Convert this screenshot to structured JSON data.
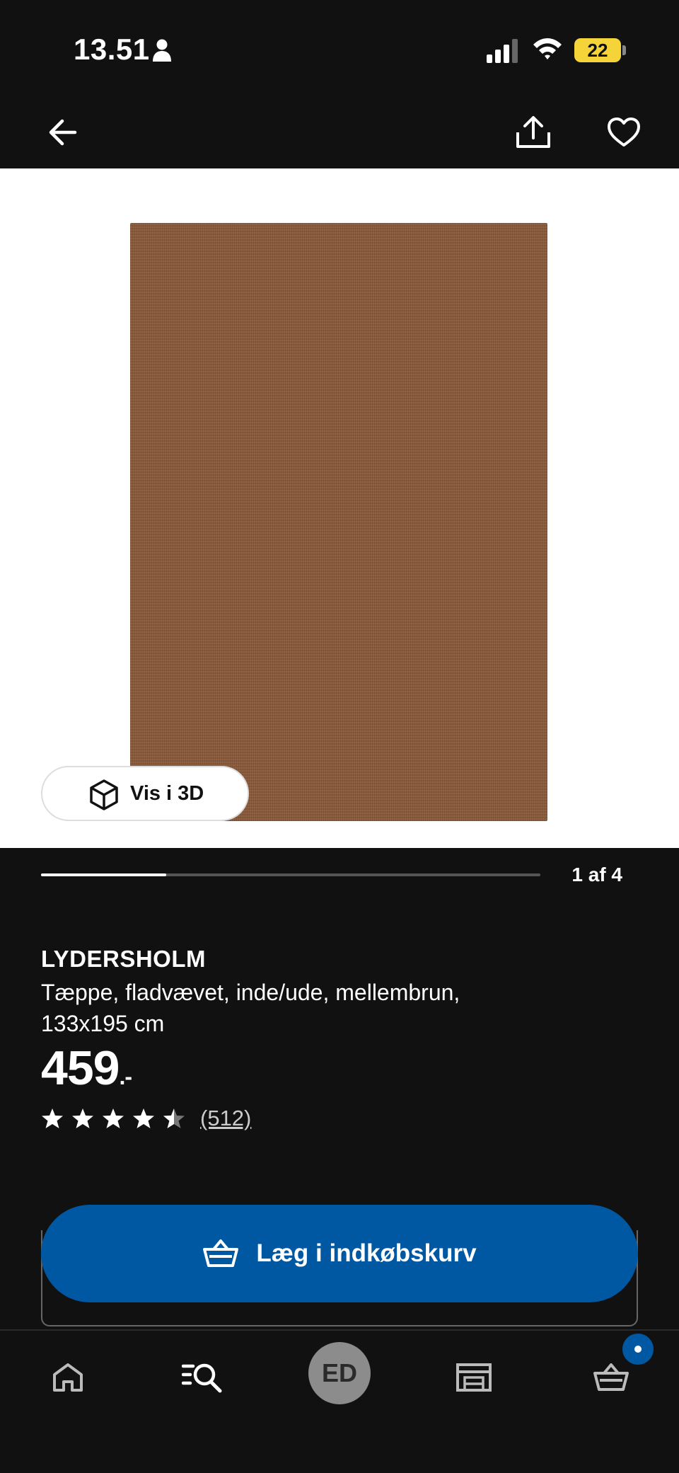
{
  "status_bar": {
    "time": "13.51",
    "battery": "22"
  },
  "top_nav": {
    "back_icon": "arrow-left-icon",
    "share_icon": "share-icon",
    "favorite_icon": "heart-icon"
  },
  "gallery": {
    "view_3d_label": "Vis i 3D",
    "counter": "1 af 4",
    "current": 1,
    "total": 4
  },
  "product": {
    "name": "LYDERSHOLM",
    "description": "Tæppe, fladvævet, inde/ude, mellembrun, 133x195 cm",
    "price": "459",
    "price_suffix": ".-",
    "rating": 4.5,
    "rating_max": 5,
    "review_count": "(512)"
  },
  "actions": {
    "add_to_cart": "Læg i indkøbskurv"
  },
  "tab_bar": {
    "items": [
      {
        "name": "home-icon"
      },
      {
        "name": "search-icon"
      },
      {
        "name": "avatar",
        "label": "ED"
      },
      {
        "name": "store-icon"
      },
      {
        "name": "cart-icon"
      }
    ]
  },
  "colors": {
    "background": "#111111",
    "accent_blue": "#0058a3",
    "rug_brown": "#8a5a3a",
    "battery_yellow": "#f5d43a"
  }
}
